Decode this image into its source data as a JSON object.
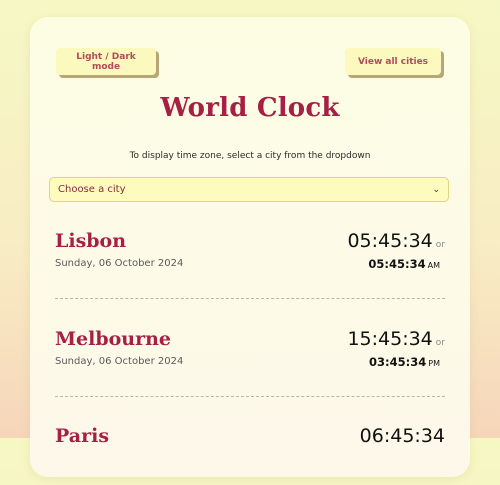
{
  "buttons": {
    "mode_label": "Light / Dark mode",
    "all_cities_label": "View all cities"
  },
  "header": {
    "title": "World Clock",
    "subtitle": "To display time zone, select a city from the dropdown"
  },
  "city_select": {
    "selected": "Choose a city"
  },
  "cities": [
    {
      "name": "Lisbon",
      "date": "Sunday, 06 October 2024",
      "time24": "05:45:34",
      "or": "or",
      "time12": "05:45:34",
      "ampm": "AM"
    },
    {
      "name": "Melbourne",
      "date": "Sunday, 06 October 2024",
      "time24": "15:45:34",
      "or": "or",
      "time12": "03:45:34",
      "ampm": "PM"
    },
    {
      "name": "Paris",
      "date": "",
      "time24": "06:45:34",
      "or": "",
      "time12": "",
      "ampm": ""
    }
  ],
  "colors": {
    "accent": "#a61f45",
    "button_bg": "#fbf9be",
    "select_bg": "#fdfbbd"
  }
}
